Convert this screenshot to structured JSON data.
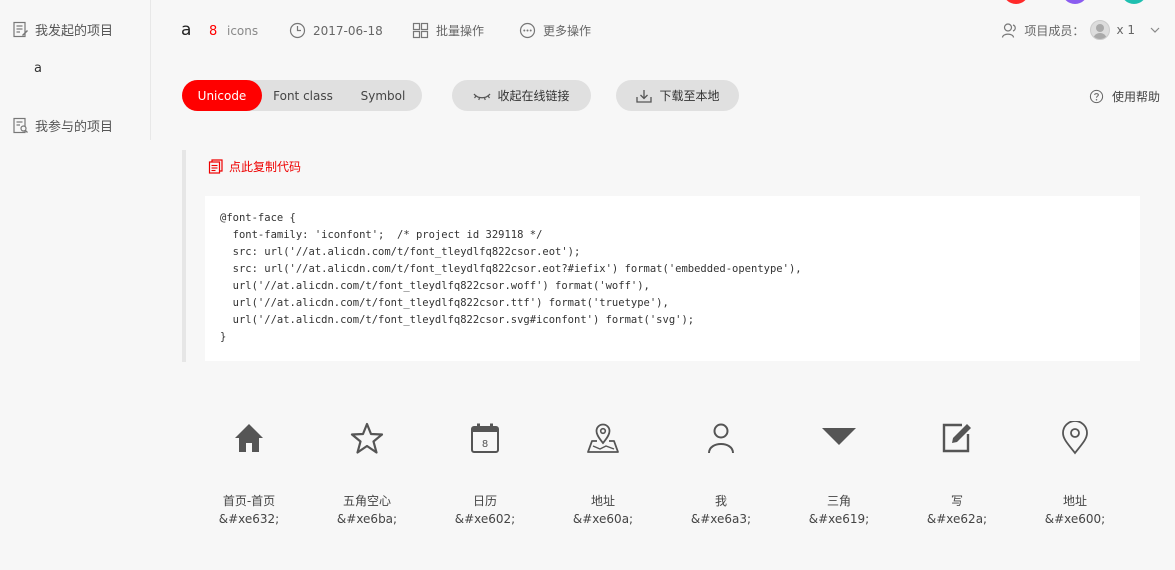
{
  "sidebar": {
    "my_projects": "我发起的项目",
    "project_item": "a",
    "joined_projects": "我参与的项目"
  },
  "header": {
    "project_name": "a",
    "icon_count": "8",
    "icon_count_label": "icons",
    "date": "2017-06-18",
    "batch_ops": "批量操作",
    "more_ops": "更多操作",
    "members_label": "项目成员：",
    "members_count": "x 1"
  },
  "tabs": [
    "Unicode",
    "Font class",
    "Symbol"
  ],
  "buttons": {
    "collapse_link": "收起在线链接",
    "download": "下载至本地",
    "help": "使用帮助"
  },
  "code_panel": {
    "copy_label": "点此复制代码",
    "code": "@font-face {\n  font-family: 'iconfont';  /* project id 329118 */\n  src: url('//at.alicdn.com/t/font_tleydlfq822csor.eot');\n  src: url('//at.alicdn.com/t/font_tleydlfq822csor.eot?#iefix') format('embedded-opentype'),\n  url('//at.alicdn.com/t/font_tleydlfq822csor.woff') format('woff'),\n  url('//at.alicdn.com/t/font_tleydlfq822csor.ttf') format('truetype'),\n  url('//at.alicdn.com/t/font_tleydlfq822csor.svg#iconfont') format('svg');\n}"
  },
  "icons": [
    {
      "name": "首页-首页",
      "code": "&#xe632;",
      "icon": "home-icon"
    },
    {
      "name": "五角空心",
      "code": "&#xe6ba;",
      "icon": "star-outline-icon"
    },
    {
      "name": "日历",
      "code": "&#xe602;",
      "icon": "calendar-icon"
    },
    {
      "name": "地址",
      "code": "&#xe60a;",
      "icon": "map-pin-icon"
    },
    {
      "name": "我",
      "code": "&#xe6a3;",
      "icon": "user-icon"
    },
    {
      "name": "三角",
      "code": "&#xe619;",
      "icon": "triangle-down-icon"
    },
    {
      "name": "写",
      "code": "&#xe62a;",
      "icon": "edit-icon"
    },
    {
      "name": "地址",
      "code": "&#xe600;",
      "icon": "location-icon"
    }
  ],
  "colors": {
    "accent": "#ff0000",
    "icon_fill": "#555555",
    "circle_1": "#ff2a2a",
    "circle_2": "#8a5cf0",
    "circle_3": "#1fbfb0"
  }
}
